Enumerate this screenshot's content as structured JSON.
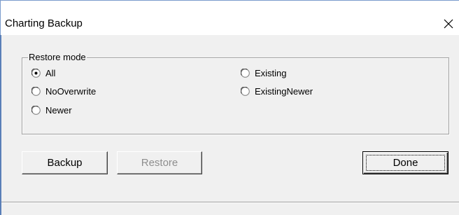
{
  "window": {
    "title": "Charting Backup",
    "close_icon": "close-icon"
  },
  "restore_group": {
    "label": "Restore mode",
    "selected": "All",
    "options": [
      {
        "label": "All",
        "checked": true
      },
      {
        "label": "Existing",
        "checked": false
      },
      {
        "label": "NoOverwrite",
        "checked": false
      },
      {
        "label": "ExistingNewer",
        "checked": false
      },
      {
        "label": "Newer",
        "checked": false
      }
    ]
  },
  "buttons": {
    "backup_label": "Backup",
    "restore_label": "Restore",
    "restore_enabled": false,
    "done_label": "Done"
  },
  "colors": {
    "window_border": "#5a7fb8",
    "face": "#f0f0f0",
    "disabled_text": "#8e8e8e"
  }
}
